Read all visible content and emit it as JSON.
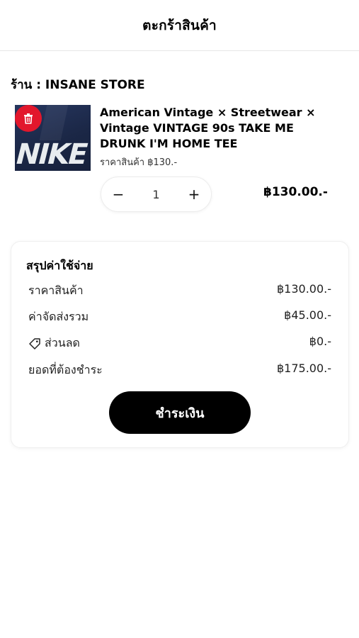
{
  "header": {
    "title": "ตะกร้าสินค้า"
  },
  "store": {
    "label": "ร้าน : INSANE STORE"
  },
  "cart_item": {
    "image_alt": "NIKE navy t-shirt",
    "image_print": "NIKE",
    "delete_icon": "trash-icon",
    "title": "American Vintage × Streetwear × Vintage VINTAGE 90s TAKE ME DRUNK I'M HOME TEE",
    "unit_price": "ราคาสินค้า ฿130.-",
    "quantity": "1",
    "minus_label": "−",
    "plus_label": "+",
    "line_total": "฿130.00.-"
  },
  "summary": {
    "title": "สรุปค่าใช้จ่าย",
    "rows": [
      {
        "label": "ราคาสินค้า",
        "value": "฿130.00.-"
      },
      {
        "label": "ค่าจัดส่งรวม",
        "value": "฿45.00.-"
      },
      {
        "label": "ส่วนลด",
        "value": "฿0.-",
        "icon": "tag-icon"
      },
      {
        "label": "ยอดที่ต้องชำระ",
        "value": "฿175.00.-"
      }
    ],
    "pay_button_label": "ชำระเงิน"
  },
  "colors": {
    "delete_button": "#e2172c",
    "pay_button": "#000000",
    "shirt": "#1c2a4f"
  }
}
